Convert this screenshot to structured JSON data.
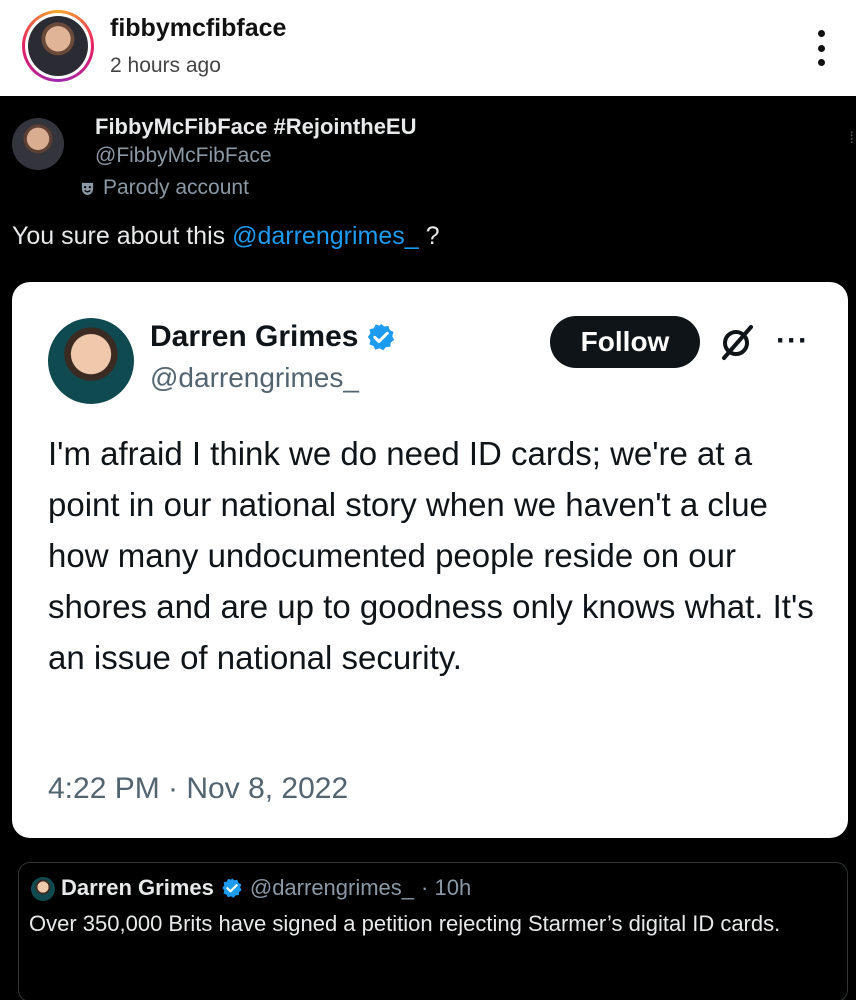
{
  "post": {
    "username": "fibbymcfibface",
    "time": "2 hours ago",
    "menu_icon": "vertical-ellipsis-icon"
  },
  "tweet": {
    "display_name": "FibbyMcFibFace #RejointheEU",
    "handle": "@FibbyMcFibFace",
    "badge_label": "Parody account",
    "text_prefix": "You sure about this ",
    "mention": "@darrengrimes_",
    "text_suffix": " ?"
  },
  "quoted_card": {
    "name": "Darren Grimes",
    "handle": "@darrengrimes_",
    "follow_label": "Follow",
    "more_label": "···",
    "body": "I'm afraid I think we do need ID cards; we're at a point in our national story when we haven't a clue how many undocumented people reside on our shores and are up to goodness only knows what. It's an issue of national security.",
    "timestamp": "4:22 PM · Nov 8, 2022",
    "verified_color": "#1d9bf0"
  },
  "quote_tweet": {
    "name": "Darren Grimes",
    "handle": "@darrengrimes_",
    "age": "· 10h",
    "text": "Over 350,000 Brits have signed a petition rejecting Starmer’s digital ID cards."
  },
  "colors": {
    "mention": "#1d9bf0",
    "dark_bg": "#000000",
    "card_bg": "#ffffff"
  }
}
